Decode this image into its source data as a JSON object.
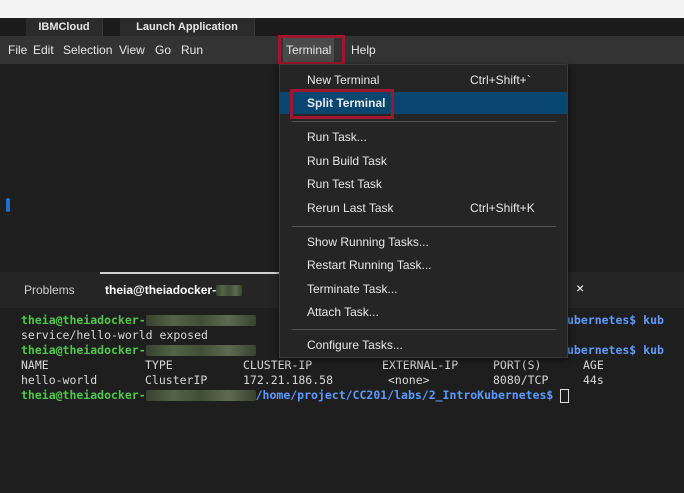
{
  "tabs": [
    {
      "label": "IBMCloud"
    },
    {
      "label": "Launch Application"
    }
  ],
  "menubar": {
    "items": [
      "File",
      "Edit",
      "Selection",
      "View",
      "Go",
      "Run",
      "Terminal",
      "Help"
    ],
    "active": "Terminal"
  },
  "terminal_menu": {
    "items": [
      {
        "label": "New Terminal",
        "shortcut": "Ctrl+Shift+`"
      },
      {
        "label": "Split Terminal",
        "shortcut": ""
      },
      {
        "label": "Run Task...",
        "shortcut": ""
      },
      {
        "label": "Run Build Task",
        "shortcut": ""
      },
      {
        "label": "Run Test Task",
        "shortcut": ""
      },
      {
        "label": "Rerun Last Task",
        "shortcut": "Ctrl+Shift+K"
      },
      {
        "label": "Show Running Tasks...",
        "shortcut": ""
      },
      {
        "label": "Restart Running Task...",
        "shortcut": ""
      },
      {
        "label": "Terminate Task...",
        "shortcut": ""
      },
      {
        "label": "Attach Task...",
        "shortcut": ""
      },
      {
        "label": "Configure Tasks...",
        "shortcut": ""
      }
    ]
  },
  "panel": {
    "tabs": [
      "Problems",
      "theia@theiadocker-"
    ],
    "close_glyph": "×"
  },
  "terminal": {
    "prompt_user": "theia@theiadocker-",
    "line2": "service/hello-world exposed",
    "prompt_tail_1": "ubernetes$ kub",
    "prompt_tail_2": "ubernetes$ kub",
    "header": [
      "NAME",
      "TYPE",
      "CLUSTER-IP",
      "EXTERNAL-IP",
      "PORT(S)",
      "AGE"
    ],
    "row": [
      "hello-world",
      "ClusterIP",
      "172.21.186.58",
      "<none>",
      "8080/TCP",
      "44s"
    ],
    "path": "/home/project/CC201/labs/2_IntroKubernetes",
    "prompt_end": "$"
  },
  "colors": {
    "highlight": "#a0162d",
    "prompt_green": "#4fc84a",
    "path_blue": "#5b9bff",
    "menu_selected": "#094771"
  },
  "icons": {
    "close": "close-icon"
  }
}
